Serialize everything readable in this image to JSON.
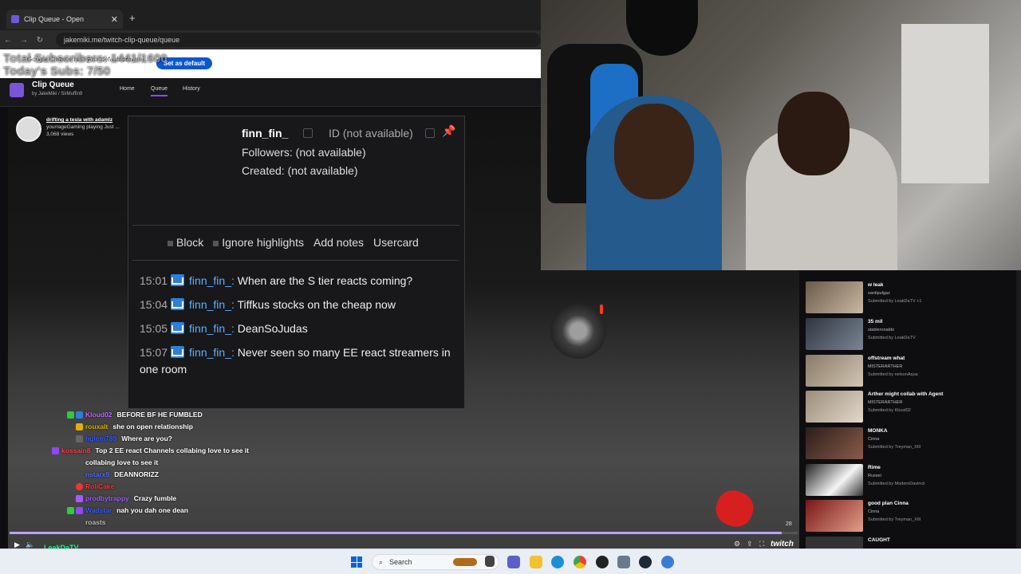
{
  "browser": {
    "tab_title": "Clip Queue - Open",
    "new_tab": "+",
    "tab_close": "✕",
    "url": "jakemiki.me/twitch-clip-queue/queue",
    "infobar_text": "Google Chrome isn't your default browser",
    "set_default_label": "Set as default"
  },
  "overlay": {
    "total_subs": "Total Subscribers: 1441/1600",
    "today_subs": "Today's Subs: 7/50"
  },
  "app": {
    "title": "Clip Queue",
    "byline": "by JakeMiki / SirMuffin9",
    "nav": [
      "Home",
      "Queue",
      "History"
    ]
  },
  "current_clip": {
    "title": "drifting a tesla with adamlz",
    "channel_line": "yourrageGaming playing Just ...",
    "views": "3,068 views"
  },
  "usercard": {
    "username": "finn_fin_",
    "id_text": "ID (not available)",
    "followers": "Followers: (not available)",
    "created": "Created: (not available)",
    "actions": [
      "Block",
      "Ignore highlights",
      "Add notes",
      "Usercard"
    ],
    "messages": [
      {
        "time": "15:01",
        "user": "finn_fin_:",
        "text": "When are the S tier reacts coming?"
      },
      {
        "time": "15:04",
        "user": "finn_fin_:",
        "text": "Tiffkus stocks on the cheap now"
      },
      {
        "time": "15:05",
        "user": "finn_fin_:",
        "text": "DeanSoJudas"
      },
      {
        "time": "15:07",
        "user": "finn_fin_:",
        "text": "Never seen so many EE react streamers in one room"
      }
    ]
  },
  "chat": [
    {
      "name": "Kloud02",
      "color": "#c06aff",
      "msg": "BEFORE BF HE FUMBLED"
    },
    {
      "name": "rouxalt",
      "color": "#e0b000",
      "msg": "she on open relationship"
    },
    {
      "name": "hglem789",
      "color": "#3a5bff",
      "msg": "Where are you?"
    },
    {
      "name": "kossain8",
      "color": "#ff4040",
      "msg": "Top 2 EE react Channels collabing love to see it"
    },
    {
      "name": "nstarx9",
      "color": "#4f6bff",
      "msg": "DEANNORIZZ"
    },
    {
      "name": "RoliCake",
      "color": "#ff3030",
      "msg": ""
    },
    {
      "name": "prodbytrappy",
      "color": "#a35cff",
      "msg": "Crazy fumble"
    },
    {
      "name": "Wadstar",
      "color": "#3a5bff",
      "msg": "nah you dah one dean"
    },
    {
      "name": "roasts",
      "color": "#bbbbbb",
      "msg": ""
    }
  ],
  "player": {
    "progress": 0.98,
    "timecode": "28",
    "bottom_name": "LeakDaTV",
    "brand": "twitch"
  },
  "queue": [
    {
      "title": "w leak",
      "channel": "santipulgaz",
      "submitted": "Submitted by LeakDaTV +1"
    },
    {
      "title": "35 mil",
      "channel": "stableronaldo",
      "submitted": "Submitted by LeakDaTV"
    },
    {
      "title": "offstream what",
      "channel": "MISTERARTHER",
      "submitted": "Submitted by nelsonAqua"
    },
    {
      "title": "Arther might collab with Agent",
      "channel": "MISTERARTHER",
      "submitted": "Submitted by Kloud02"
    },
    {
      "title": "MONKA",
      "channel": "Cinna",
      "submitted": "Submitted by Treyman_XIII"
    },
    {
      "title": "Rime",
      "channel": "Russel",
      "submitted": "Submitted by ModeroDavincii"
    },
    {
      "title": "good plan Cinna",
      "channel": "Cinna",
      "submitted": "Submitted by Treyman_XIII"
    },
    {
      "title": "CAUGHT",
      "channel": "",
      "submitted": ""
    }
  ],
  "taskbar": {
    "search_label": "Search"
  },
  "colors": {
    "accent": "#9147ff",
    "link_blue": "#5ab0ff",
    "default_btn": "#0b57d0"
  }
}
